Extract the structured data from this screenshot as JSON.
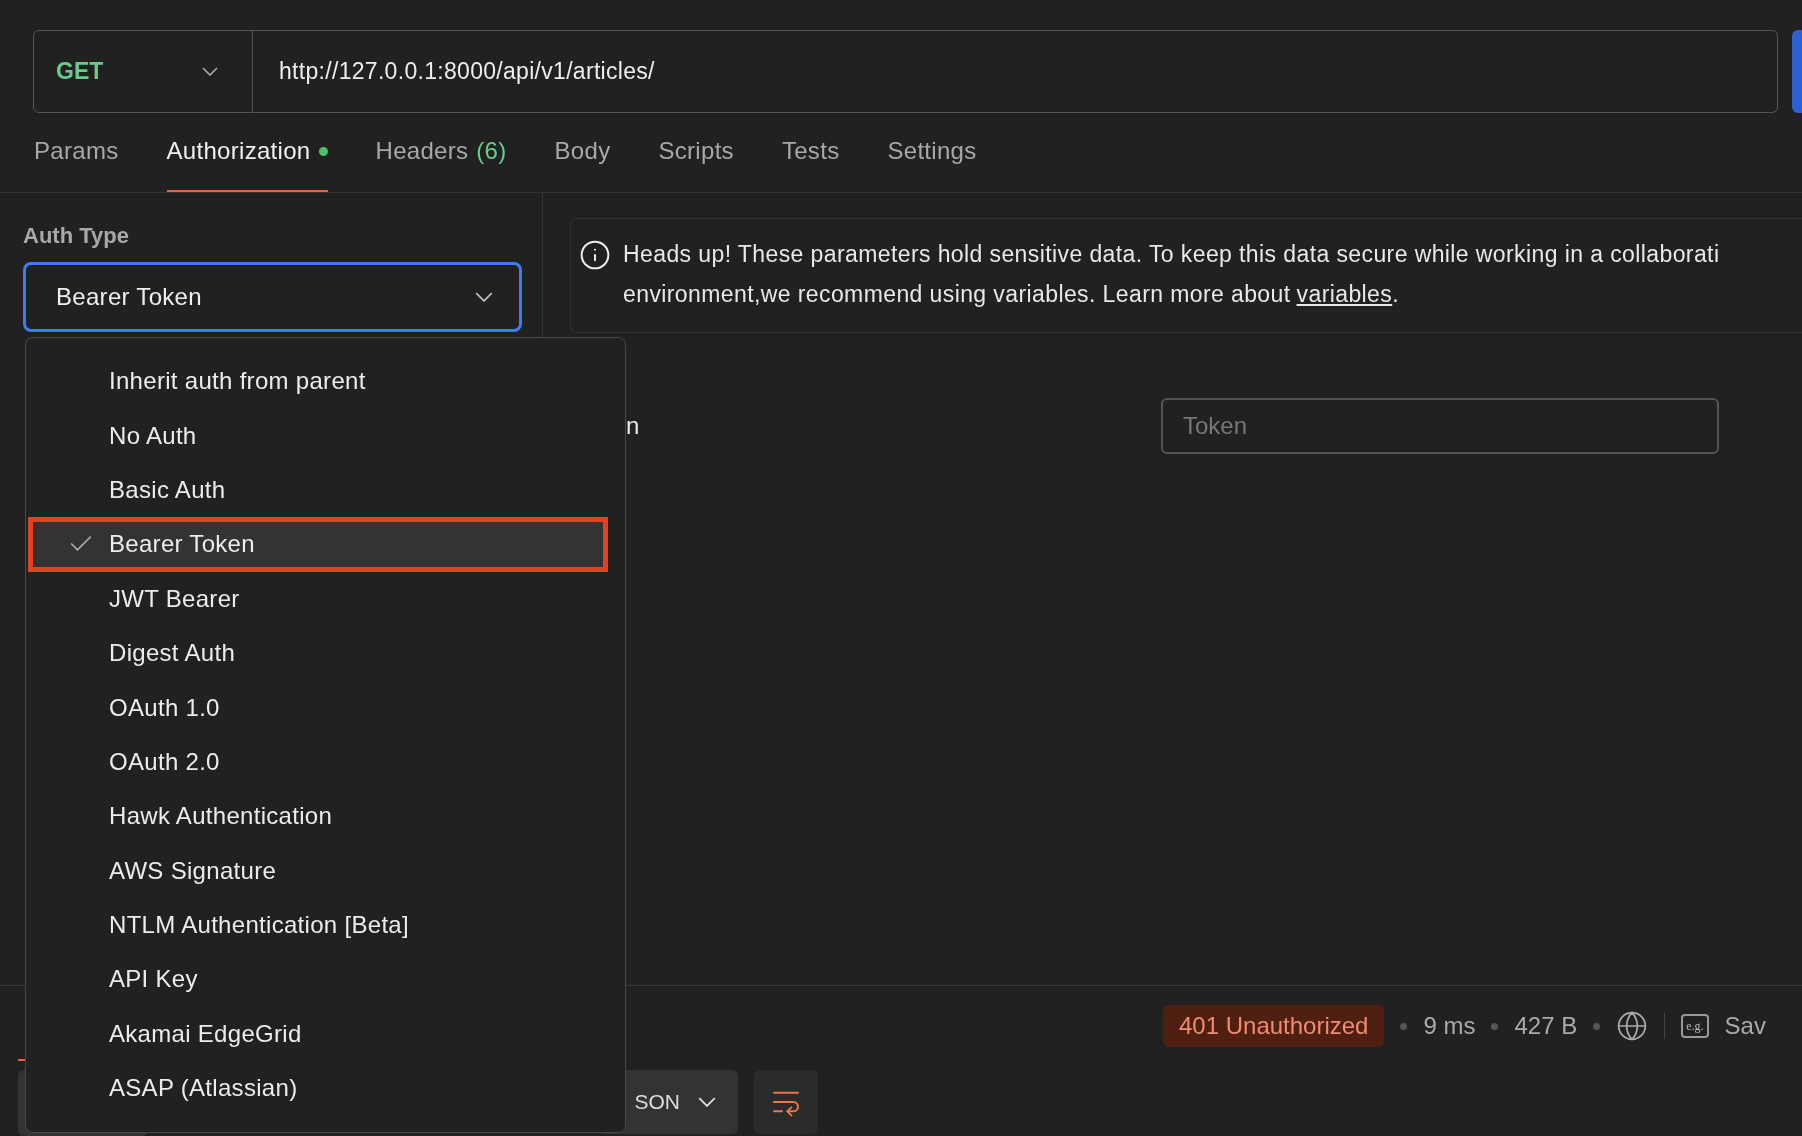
{
  "request": {
    "method": "GET",
    "url": "http://127.0.0.1:8000/api/v1/articles/"
  },
  "tabs": [
    {
      "label": "Params",
      "selected": false,
      "dot": false
    },
    {
      "label": "Authorization",
      "selected": true,
      "dot": true
    },
    {
      "label": "Headers",
      "count": "(6)",
      "selected": false,
      "dot": false
    },
    {
      "label": "Body",
      "selected": false,
      "dot": false
    },
    {
      "label": "Scripts",
      "selected": false,
      "dot": false
    },
    {
      "label": "Tests",
      "selected": false,
      "dot": false
    },
    {
      "label": "Settings",
      "selected": false,
      "dot": false
    }
  ],
  "auth": {
    "label": "Auth Type",
    "value": "Bearer Token",
    "options": [
      {
        "label": "Inherit auth from parent",
        "selected": false
      },
      {
        "label": "No Auth",
        "selected": false
      },
      {
        "label": "Basic Auth",
        "selected": false
      },
      {
        "label": "Bearer Token",
        "selected": true
      },
      {
        "label": "JWT Bearer",
        "selected": false
      },
      {
        "label": "Digest Auth",
        "selected": false
      },
      {
        "label": "OAuth 1.0",
        "selected": false
      },
      {
        "label": "OAuth 2.0",
        "selected": false
      },
      {
        "label": "Hawk Authentication",
        "selected": false
      },
      {
        "label": "AWS Signature",
        "selected": false
      },
      {
        "label": "NTLM Authentication [Beta]",
        "selected": false
      },
      {
        "label": "API Key",
        "selected": false
      },
      {
        "label": "Akamai EdgeGrid",
        "selected": false
      },
      {
        "label": "ASAP (Atlassian)",
        "selected": false
      }
    ]
  },
  "notice": {
    "line1": "Heads up! These parameters hold sensitive data. To keep this data secure while working in a collaborati",
    "line2": "environment,we recommend using variables. Learn more about",
    "link": "variables",
    "end": "."
  },
  "token": {
    "label": "n",
    "placeholder": "Token"
  },
  "response": {
    "status": "401 Unauthorized",
    "time": "9 ms",
    "size": "427 B",
    "example": "e.g.",
    "save": "Sav",
    "format": "SON"
  }
}
